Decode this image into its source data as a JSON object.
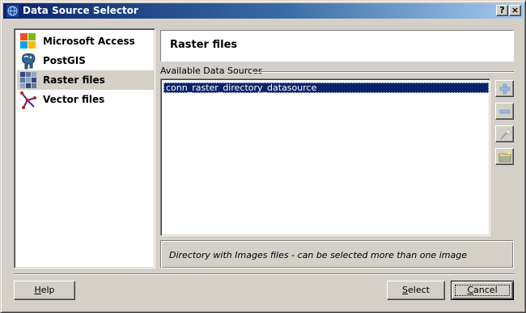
{
  "window": {
    "title": "Data Source Selector",
    "help_button": "?",
    "close_button": "×"
  },
  "left_list": {
    "selected_index": 2,
    "items": [
      {
        "label": "Microsoft Access",
        "icon": "microsoft-access-icon"
      },
      {
        "label": "PostGIS",
        "icon": "postgis-elephant-icon"
      },
      {
        "label": "Raster files",
        "icon": "raster-grid-icon"
      },
      {
        "label": "Vector files",
        "icon": "vector-files-icon"
      }
    ]
  },
  "header": {
    "title": "Raster files"
  },
  "available": {
    "label": "Available Data Sources",
    "rows": [
      "conn_raster_directory_datasource"
    ],
    "selected_index": 0
  },
  "side_buttons": [
    {
      "name": "add-datasource-button",
      "icon": "plus-icon"
    },
    {
      "name": "remove-datasource-button",
      "icon": "minus-icon"
    },
    {
      "name": "edit-datasource-button",
      "icon": "wand-icon"
    },
    {
      "name": "open-directory-button",
      "icon": "folder-icon"
    }
  ],
  "description": "Directory with Images files - can be selected more than one image",
  "buttons": {
    "help": "Help",
    "help_mnemonic": "H",
    "help_rest": "elp",
    "select": "Select",
    "select_mnemonic": "S",
    "select_rest": "elect",
    "cancel": "Cancel",
    "cancel_mnemonic": "C",
    "cancel_rest": "ancel"
  },
  "colors": {
    "title_start": "#0a246a",
    "title_end": "#a6caf0",
    "selection": "#0a246a",
    "face": "#d4d0c8"
  }
}
